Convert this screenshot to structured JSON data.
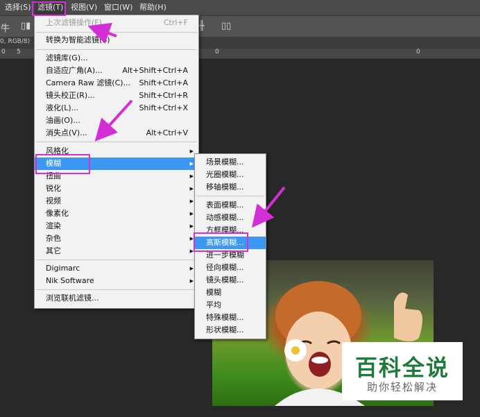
{
  "menubar": {
    "items": [
      "选择(S)",
      "滤镜(T)",
      "视图(V)",
      "窗口(W)",
      "帮助(H)"
    ]
  },
  "toolbar": {
    "left_glyph": "牛"
  },
  "document_tab": {
    "label": "0, RGB/8)"
  },
  "ruler": {
    "ticks": [
      "0",
      "5",
      "0",
      "0"
    ]
  },
  "filter_menu": {
    "items": [
      {
        "label": "上次滤镜操作(F)",
        "shortcut": "Ctrl+F"
      },
      {
        "label": "转换为智能滤镜(S)",
        "shortcut": ""
      },
      {
        "label": "滤镜库(G)...",
        "shortcut": ""
      },
      {
        "label": "自适应广角(A)...",
        "shortcut": "Alt+Shift+Ctrl+A"
      },
      {
        "label": "Camera Raw 滤镜(C)...",
        "shortcut": "Shift+Ctrl+A"
      },
      {
        "label": "镜头校正(R)...",
        "shortcut": "Shift+Ctrl+R"
      },
      {
        "label": "液化(L)...",
        "shortcut": "Shift+Ctrl+X"
      },
      {
        "label": "油画(O)...",
        "shortcut": ""
      },
      {
        "label": "消失点(V)...",
        "shortcut": "Alt+Ctrl+V"
      },
      {
        "label": "风格化",
        "shortcut": ""
      },
      {
        "label": "模糊",
        "shortcut": ""
      },
      {
        "label": "扭曲",
        "shortcut": ""
      },
      {
        "label": "锐化",
        "shortcut": ""
      },
      {
        "label": "视频",
        "shortcut": ""
      },
      {
        "label": "像素化",
        "shortcut": ""
      },
      {
        "label": "渲染",
        "shortcut": ""
      },
      {
        "label": "杂色",
        "shortcut": ""
      },
      {
        "label": "其它",
        "shortcut": ""
      },
      {
        "label": "Digimarc",
        "shortcut": ""
      },
      {
        "label": "Nik Software",
        "shortcut": ""
      },
      {
        "label": "浏览联机滤镜...",
        "shortcut": ""
      }
    ]
  },
  "blur_menu": {
    "items": [
      "场景模糊...",
      "光圈模糊...",
      "移轴模糊...",
      "表面模糊...",
      "动感模糊...",
      "方框模糊...",
      "高斯模糊...",
      "进一步模糊",
      "径向模糊...",
      "镜头模糊...",
      "模糊",
      "平均",
      "特殊模糊...",
      "形状模糊..."
    ]
  },
  "watermark": {
    "title": "百科全说",
    "subtitle": "助你轻松解决"
  },
  "colors": {
    "highlight": "#3c97f0",
    "annotation": "#d42fd6"
  }
}
